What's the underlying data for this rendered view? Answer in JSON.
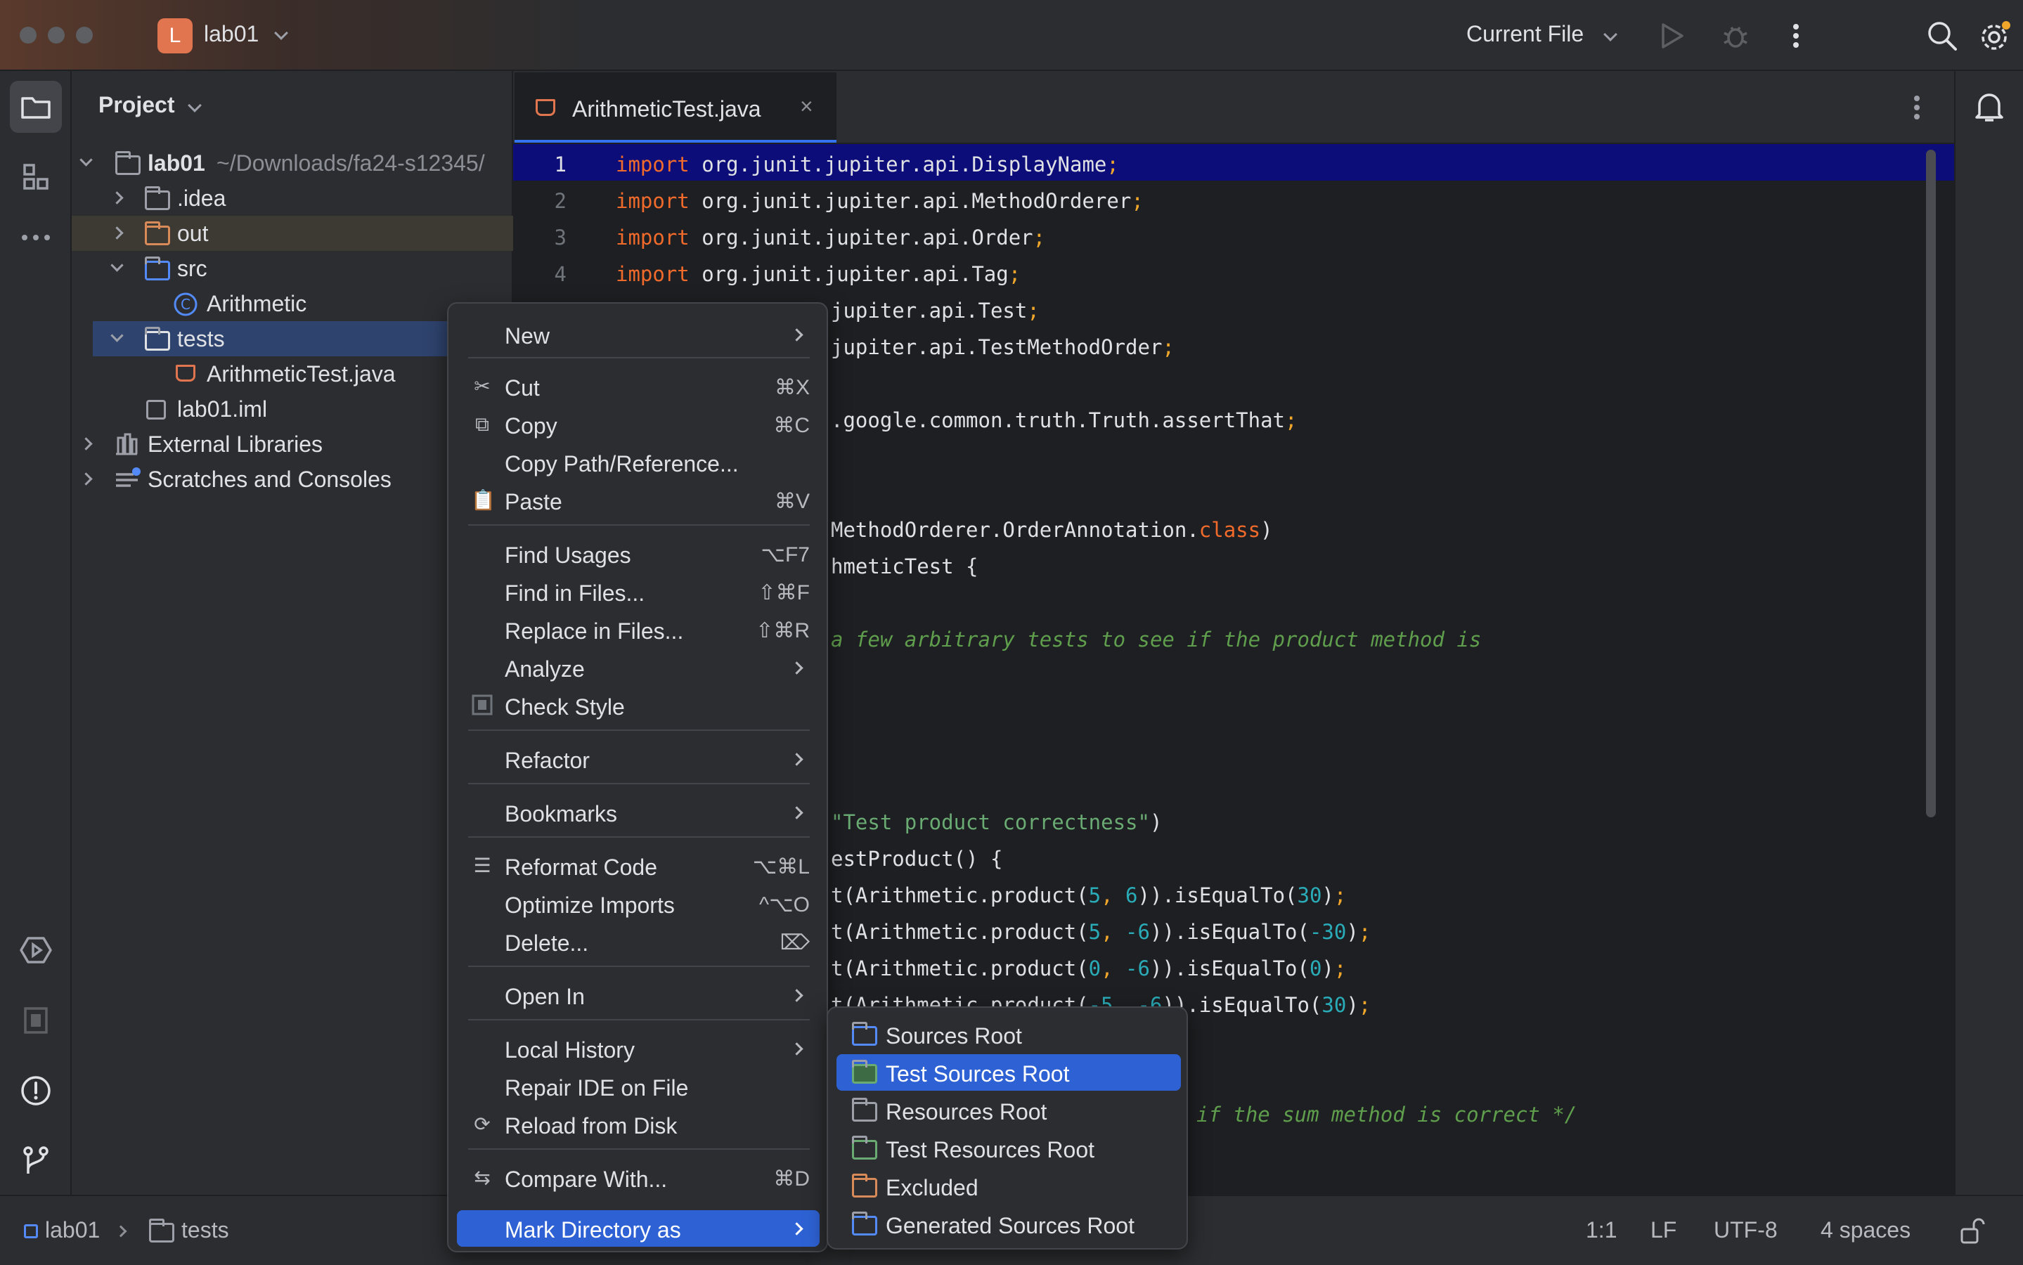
{
  "window": {
    "project_badge": "L",
    "project_name": "lab01",
    "run_config": "Current File"
  },
  "project_panel": {
    "title": "Project",
    "tree": [
      {
        "label": "lab01",
        "detail": "~/Downloads/fa24-s12345/"
      },
      {
        "label": ".idea"
      },
      {
        "label": "out"
      },
      {
        "label": "src"
      },
      {
        "label": "Arithmetic"
      },
      {
        "label": "tests"
      },
      {
        "label": "ArithmeticTest.java"
      },
      {
        "label": "lab01.iml"
      },
      {
        "label": "External Libraries"
      },
      {
        "label": "Scratches and Consoles"
      }
    ]
  },
  "editor": {
    "tab_label": "ArithmeticTest.java",
    "tab_close": "×",
    "line_numbers": [
      "1",
      "2",
      "3",
      "4"
    ],
    "code": {
      "l1": {
        "kw": "import",
        "rest": " org.junit.jupiter.api.DisplayName",
        "semi": ";"
      },
      "l2": {
        "kw": "import",
        "rest": " org.junit.jupiter.api.MethodOrderer",
        "semi": ";"
      },
      "l3": {
        "kw": "import",
        "rest": " org.junit.jupiter.api.Order",
        "semi": ";"
      },
      "l4": {
        "kw": "import",
        "rest": " org.junit.jupiter.api.Tag",
        "semi": ";"
      },
      "l5": {
        "rest": "jupiter.api.Test",
        "semi": ";"
      },
      "l6": {
        "rest": "jupiter.api.TestMethodOrder",
        "semi": ";"
      },
      "l8": {
        "rest": ".google.common.truth.Truth.assertThat",
        "semi": ";"
      },
      "l11": {
        "a": "MethodOrderer.OrderAnnotation.",
        "kw": "class",
        "b": ")"
      },
      "l12": {
        "rest": "hmeticTest {"
      },
      "l14": {
        "comment": "a few arbitrary tests to see if the product method is"
      },
      "l19": {
        "str": "\"Test product correctness\"",
        "b": ")"
      },
      "l20": {
        "rest": "estProduct() {"
      },
      "l21": {
        "a": "t(Arithmetic.product(",
        "n1": "5",
        "c": ", ",
        "n2": "6",
        "d": ")).isEqualTo(",
        "n3": "30",
        "e": ")",
        "semi": ";"
      },
      "l22": {
        "a": "t(Arithmetic.product(",
        "n1": "5",
        "c": ", ",
        "n2": "-6",
        "d": ")).isEqualTo(",
        "n3": "-30",
        "e": ")",
        "semi": ";"
      },
      "l23": {
        "a": "t(Arithmetic.product(",
        "n1": "0",
        "c": ", ",
        "n2": "-6",
        "d": ")).isEqualTo(",
        "n3": "0",
        "e": ")",
        "semi": ";"
      },
      "l24": {
        "a": "t(Arithmetic.product(",
        "n1": "-5",
        "c": ", ",
        "n2": "-6",
        "d": ")).isEqualTo(",
        "n3": "30",
        "e": ")",
        "semi": ";"
      },
      "l27": {
        "comment": "if the sum method is correct */"
      }
    }
  },
  "context_menu": {
    "items": [
      {
        "label": "New",
        "shortcut": "",
        "submenu": true
      },
      {
        "label": "Cut",
        "shortcut": "⌘X"
      },
      {
        "label": "Copy",
        "shortcut": "⌘C"
      },
      {
        "label": "Copy Path/Reference...",
        "shortcut": ""
      },
      {
        "label": "Paste",
        "shortcut": "⌘V"
      },
      {
        "label": "Find Usages",
        "shortcut": "⌥F7"
      },
      {
        "label": "Find in Files...",
        "shortcut": "⇧⌘F"
      },
      {
        "label": "Replace in Files...",
        "shortcut": "⇧⌘R"
      },
      {
        "label": "Analyze",
        "submenu": true
      },
      {
        "label": "Check Style",
        "shortcut": ""
      },
      {
        "label": "Refactor",
        "submenu": true
      },
      {
        "label": "Bookmarks",
        "submenu": true
      },
      {
        "label": "Reformat Code",
        "shortcut": "⌥⌘L"
      },
      {
        "label": "Optimize Imports",
        "shortcut": "^⌥O"
      },
      {
        "label": "Delete...",
        "shortcut": "⌦"
      },
      {
        "label": "Open In",
        "submenu": true
      },
      {
        "label": "Local History",
        "submenu": true
      },
      {
        "label": "Repair IDE on File",
        "shortcut": ""
      },
      {
        "label": "Reload from Disk",
        "shortcut": ""
      },
      {
        "label": "Compare With...",
        "shortcut": "⌘D"
      },
      {
        "label": "Mark Directory as",
        "submenu": true,
        "highlighted": true
      }
    ]
  },
  "mark_submenu": {
    "items": [
      {
        "label": "Sources Root"
      },
      {
        "label": "Test Sources Root",
        "highlighted": true
      },
      {
        "label": "Resources Root"
      },
      {
        "label": "Test Resources Root"
      },
      {
        "label": "Excluded"
      },
      {
        "label": "Generated Sources Root"
      }
    ]
  },
  "status_bar": {
    "breadcrumb": [
      "lab01",
      "tests"
    ],
    "position": "1:1",
    "line_sep": "LF",
    "encoding": "UTF-8",
    "indent": "4 spaces"
  },
  "colors": {
    "accent": "#3574f0",
    "selection": "#2e62d4",
    "keyword": "#f06a2b",
    "number": "#2aacb8",
    "string": "#6aab73",
    "comment": "#5f9e4c",
    "excluded_folder": "#d88b58"
  },
  "icons": [
    "folder-icon",
    "structure-icon",
    "more-icon",
    "run-icon",
    "debug-icon",
    "kebab-icon",
    "search-icon",
    "settings-icon",
    "notifications-icon",
    "services-icon",
    "problems-icon",
    "git-icon",
    "scissors-icon",
    "copy-icon",
    "paste-icon",
    "reformat-icon",
    "reload-icon",
    "compare-icon",
    "lock-icon"
  ]
}
